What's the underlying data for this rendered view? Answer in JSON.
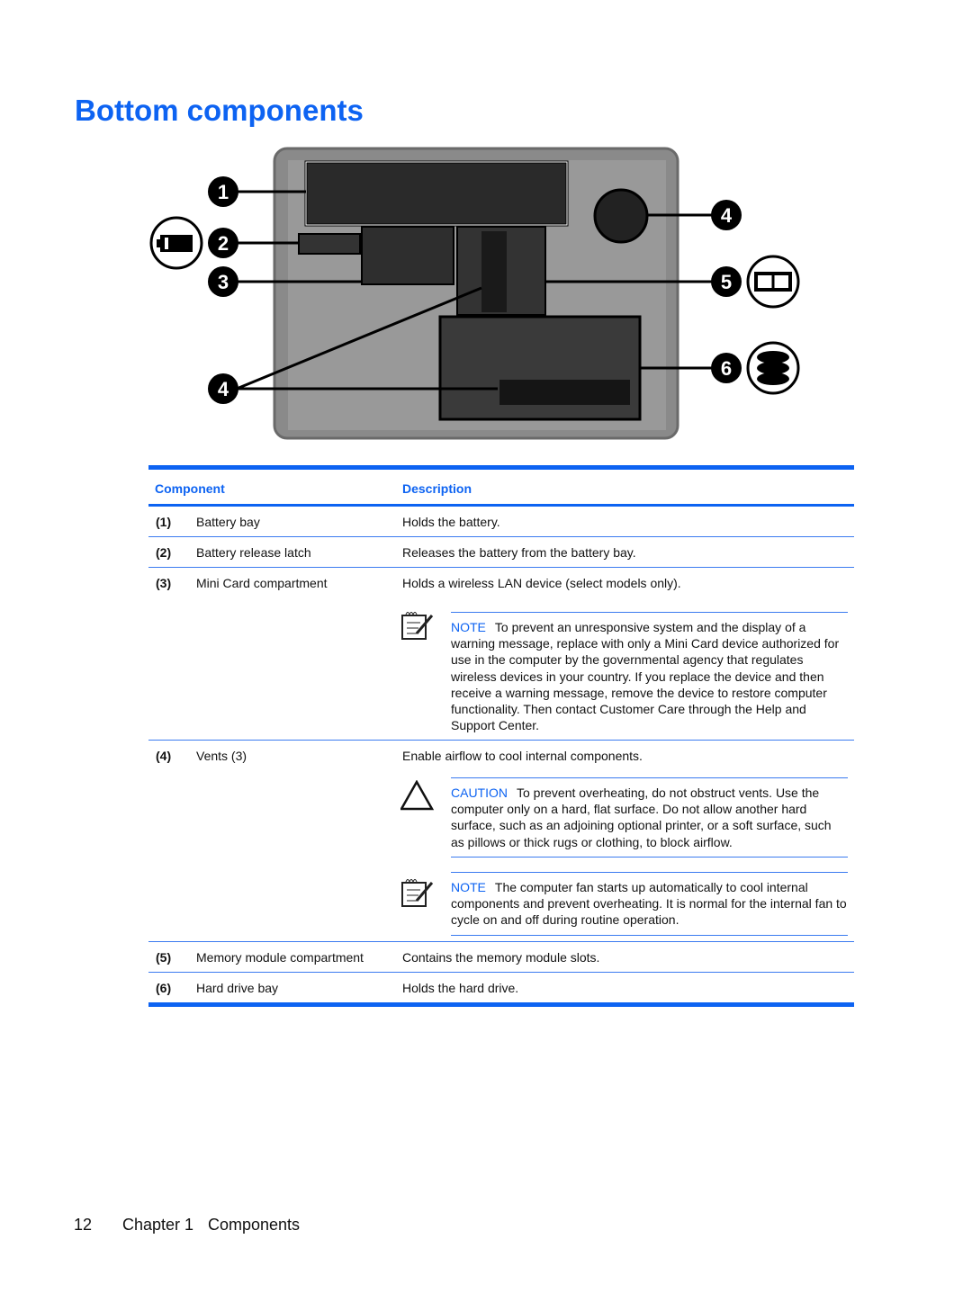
{
  "title": "Bottom components",
  "figure": {
    "callouts": [
      "1",
      "2",
      "3",
      "4",
      "5",
      "4",
      "6"
    ]
  },
  "table": {
    "headers": {
      "component": "Component",
      "description": "Description"
    },
    "rows": [
      {
        "num": "(1)",
        "component": "Battery bay",
        "description": "Holds the battery."
      },
      {
        "num": "(2)",
        "component": "Battery release latch",
        "description": "Releases the battery from the battery bay."
      },
      {
        "num": "(3)",
        "component": "Mini Card compartment",
        "description": "Holds a wireless LAN device (select models only).",
        "notes": [
          {
            "type": "NOTE",
            "text": "To prevent an unresponsive system and the display of a warning message, replace with only a Mini Card device authorized for use in the computer by the governmental agency that regulates wireless devices in your country. If you replace the device and then receive a warning message, remove the device to restore computer functionality. Then contact Customer Care through the Help and Support Center."
          }
        ]
      },
      {
        "num": "(4)",
        "component": "Vents (3)",
        "description": "Enable airflow to cool internal components.",
        "notes": [
          {
            "type": "CAUTION",
            "text": "To prevent overheating, do not obstruct vents. Use the computer only on a hard, flat surface. Do not allow another hard surface, such as an adjoining optional printer, or a soft surface, such as pillows or thick rugs or clothing, to block airflow."
          },
          {
            "type": "NOTE",
            "text": "The computer fan starts up automatically to cool internal components and prevent overheating. It is normal for the internal fan to cycle on and off during routine operation."
          }
        ]
      },
      {
        "num": "(5)",
        "component": "Memory module compartment",
        "description": "Contains the memory module slots."
      },
      {
        "num": "(6)",
        "component": "Hard drive bay",
        "description": "Holds the hard drive."
      }
    ]
  },
  "footer": {
    "page": "12",
    "chapter": "Chapter 1",
    "section": "Components"
  }
}
